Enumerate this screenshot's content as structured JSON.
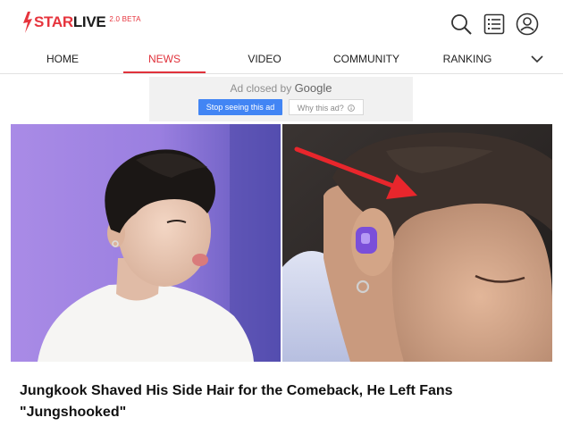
{
  "brand": {
    "star": "STAR",
    "live": "LIVE",
    "badge": "2.0 BETA"
  },
  "header_icons": [
    "search-icon",
    "list-icon",
    "user-icon"
  ],
  "nav": {
    "items": [
      "HOME",
      "NEWS",
      "VIDEO",
      "COMMUNITY",
      "RANKING"
    ],
    "active_index": 1,
    "more_icon": "chevron-down-icon"
  },
  "ad": {
    "closed_by": "Ad closed by",
    "google": "Google",
    "stop_label": "Stop seeing this ad",
    "why_label": "Why this ad?",
    "why_icon": "info-icon"
  },
  "article": {
    "headline": "Jungkook Shaved His Side Hair for the Comeback, He Left Fans \"Jungshooked\""
  },
  "colors": {
    "brand_red": "#e6343d",
    "ad_button_blue": "#4285f4",
    "arrow_red": "#e8262c"
  }
}
